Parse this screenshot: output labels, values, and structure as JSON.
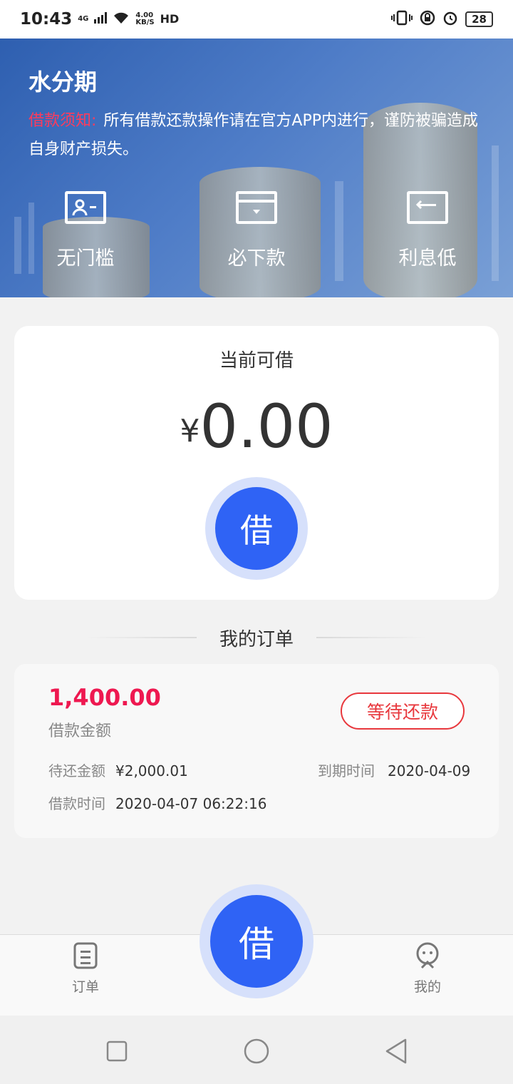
{
  "status_bar": {
    "time": "10:43",
    "network": "4G",
    "speed_value": "4.00",
    "speed_unit": "KB/S",
    "hd": "HD",
    "battery": "28"
  },
  "header": {
    "app_title": "水分期",
    "notice_label": "借款须知:",
    "notice_text": "所有借款还款操作请在官方APP内进行，谨防被骗造成自身财产损失。",
    "features": [
      {
        "icon": "id-card-icon",
        "label": "无门槛"
      },
      {
        "icon": "wallet-icon",
        "label": "必下款"
      },
      {
        "icon": "card-return-icon",
        "label": "利息低"
      }
    ]
  },
  "loan_card": {
    "title": "当前可借",
    "currency": "¥",
    "amount": "0.00",
    "borrow_label": "借"
  },
  "orders_section": {
    "title": "我的订单"
  },
  "order": {
    "amount": "1,400.00",
    "amount_label": "借款金额",
    "status": "等待还款",
    "due_amount_label": "待还金额",
    "due_amount": "¥2,000.01",
    "due_date_label": "到期时间",
    "due_date": "2020-04-09",
    "loan_time_label": "借款时间",
    "loan_time": "2020-04-07 06:22:16"
  },
  "bottom_nav": {
    "orders_label": "订单",
    "center_label": "借",
    "mine_label": "我的"
  },
  "colors": {
    "primary": "#2f63f5",
    "amount_red": "#ee1850",
    "status_red": "#e8383d",
    "notice_red": "#ff3b5c"
  }
}
